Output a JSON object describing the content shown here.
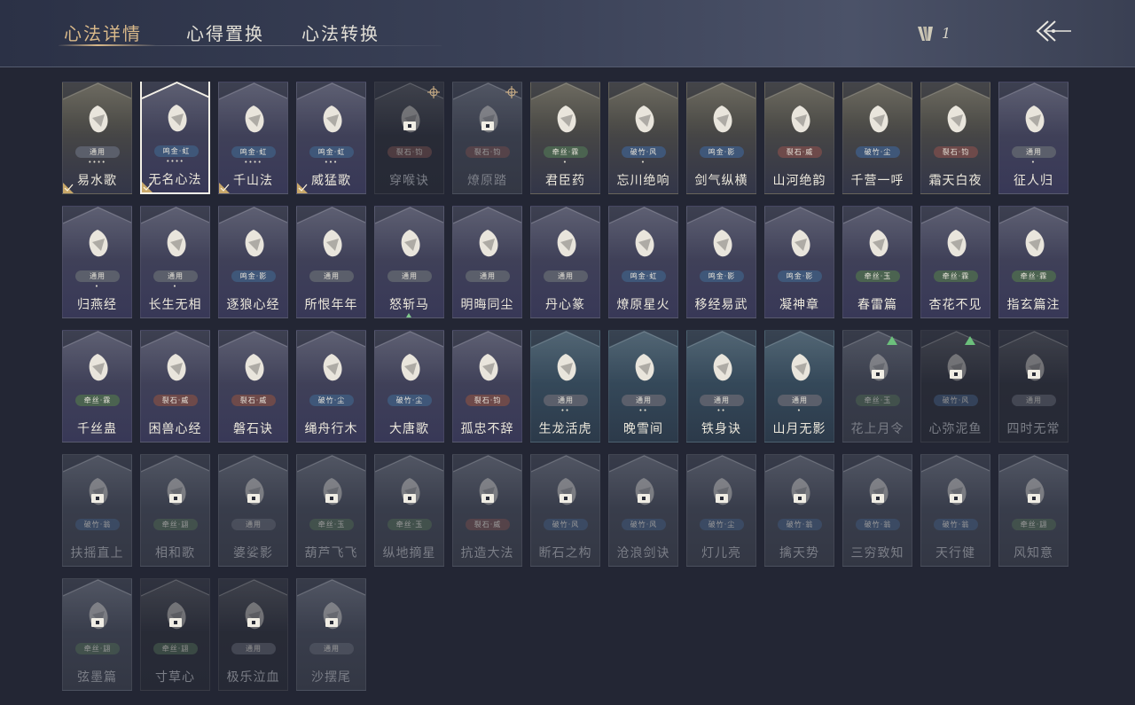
{
  "tabs": [
    {
      "label": "心法详情",
      "active": true
    },
    {
      "label": "心得置换",
      "active": false
    },
    {
      "label": "心法转换",
      "active": false
    }
  ],
  "counter": {
    "value": "1",
    "icon": "arrows-bundle-icon"
  },
  "back": {
    "icon": "back-arrow-icon"
  },
  "cards": [
    {
      "name": "易水歌",
      "tag": "通用",
      "tagType": "gen",
      "dots": "••••",
      "style": "gold",
      "icon": "horse-icon",
      "corner": true
    },
    {
      "name": "无名心法",
      "tag": "鸣金·虹",
      "tagType": "blue",
      "dots": "••••",
      "style": "purple",
      "icon": "sword-icon",
      "corner": true,
      "selected": true
    },
    {
      "name": "千山法",
      "tag": "鸣金·虹",
      "tagType": "blue",
      "dots": "••••",
      "style": "purple",
      "icon": "mountain-icon",
      "corner": true
    },
    {
      "name": "威猛歌",
      "tag": "鸣金·虹",
      "tagType": "blue",
      "dots": "•••",
      "style": "purple",
      "icon": "fist-icon",
      "corner": true
    },
    {
      "name": "穿喉诀",
      "tag": "裂石·钧",
      "tagType": "red",
      "dots": "",
      "style": "dark",
      "icon": "mask-icon",
      "lock": true,
      "target": true
    },
    {
      "name": "燎原踏",
      "tag": "裂石·钧",
      "tagType": "red",
      "dots": "",
      "style": "dim",
      "icon": "rider-icon",
      "lock": true,
      "target": true
    },
    {
      "name": "君臣药",
      "tag": "牵丝·霖",
      "tagType": "green",
      "dots": "•",
      "style": "gold",
      "icon": "jar-icon"
    },
    {
      "name": "忘川绝响",
      "tag": "破竹·风",
      "tagType": "blue",
      "dots": "•",
      "style": "gold",
      "icon": "face-icon"
    },
    {
      "name": "剑气纵横",
      "tag": "鸣金·影",
      "tagType": "blue",
      "dots": "",
      "style": "gold",
      "icon": "swords-icon"
    },
    {
      "name": "山河绝韵",
      "tag": "裂石·威",
      "tagType": "red",
      "dots": "",
      "style": "gold",
      "icon": "landscape-icon"
    },
    {
      "name": "千营一呼",
      "tag": "破竹·尘",
      "tagType": "blue",
      "dots": "",
      "style": "gold",
      "icon": "flag-icon"
    },
    {
      "name": "霜天白夜",
      "tag": "裂石·钧",
      "tagType": "red",
      "dots": "",
      "style": "gold",
      "icon": "spear-icon"
    },
    {
      "name": "征人归",
      "tag": "通用",
      "tagType": "gen",
      "dots": "•",
      "style": "purple",
      "icon": "bird-icon"
    },
    {
      "name": "归燕经",
      "tag": "通用",
      "tagType": "gen",
      "dots": "•",
      "style": "purple",
      "icon": "swallow-icon"
    },
    {
      "name": "长生无相",
      "tag": "通用",
      "tagType": "gen",
      "dots": "•",
      "style": "purple",
      "icon": "statue-icon"
    },
    {
      "name": "逐狼心经",
      "tag": "鸣金·影",
      "tagType": "blue",
      "dots": "",
      "style": "purple",
      "icon": "wolf-icon"
    },
    {
      "name": "所恨年年",
      "tag": "通用",
      "tagType": "gen",
      "dots": "",
      "style": "purple",
      "icon": "branch-icon"
    },
    {
      "name": "怒斩马",
      "tag": "通用",
      "tagType": "gen",
      "dots": "",
      "style": "purple",
      "icon": "blade-icon",
      "smalltri": true
    },
    {
      "name": "明晦同尘",
      "tag": "通用",
      "tagType": "gen",
      "dots": "",
      "style": "purple",
      "icon": "knot-icon"
    },
    {
      "name": "丹心篆",
      "tag": "通用",
      "tagType": "gen",
      "dots": "",
      "style": "purple",
      "icon": "seal-icon"
    },
    {
      "name": "燎原星火",
      "tag": "鸣金·虹",
      "tagType": "blue",
      "dots": "",
      "style": "purple",
      "icon": "scythe-icon"
    },
    {
      "name": "移经易武",
      "tag": "鸣金·影",
      "tagType": "blue",
      "dots": "",
      "style": "purple",
      "icon": "warrior-icon"
    },
    {
      "name": "凝神章",
      "tag": "鸣金·影",
      "tagType": "blue",
      "dots": "",
      "style": "purple",
      "icon": "bow-icon"
    },
    {
      "name": "春雷篇",
      "tag": "牵丝·玉",
      "tagType": "green",
      "dots": "",
      "style": "purple",
      "icon": "lightning-icon"
    },
    {
      "name": "杏花不见",
      "tag": "牵丝·霖",
      "tagType": "green",
      "dots": "",
      "style": "purple",
      "icon": "flower-icon"
    },
    {
      "name": "指玄篇注",
      "tag": "牵丝·霖",
      "tagType": "green",
      "dots": "",
      "style": "purple",
      "icon": "yinyang-icon"
    },
    {
      "name": "千丝蛊",
      "tag": "牵丝·霖",
      "tagType": "green",
      "dots": "",
      "style": "purple",
      "icon": "leaf-icon"
    },
    {
      "name": "困兽心经",
      "tag": "裂石·威",
      "tagType": "red",
      "dots": "",
      "style": "purple",
      "icon": "cage-icon"
    },
    {
      "name": "磐石诀",
      "tag": "裂石·威",
      "tagType": "red",
      "dots": "",
      "style": "purple",
      "icon": "rock-icon"
    },
    {
      "name": "绳舟行木",
      "tag": "破竹·尘",
      "tagType": "blue",
      "dots": "",
      "style": "purple",
      "icon": "roots-icon"
    },
    {
      "name": "大唐歌",
      "tag": "破竹·尘",
      "tagType": "blue",
      "dots": "",
      "style": "purple",
      "icon": "palace-icon"
    },
    {
      "name": "孤忠不辞",
      "tag": "裂石·钧",
      "tagType": "red",
      "dots": "",
      "style": "purple",
      "icon": "crossed-weapons-icon"
    },
    {
      "name": "生龙活虎",
      "tag": "通用",
      "tagType": "gen",
      "dots": "••",
      "style": "teal",
      "icon": "hammer-circle-icon"
    },
    {
      "name": "晚雪间",
      "tag": "通用",
      "tagType": "gen",
      "dots": "••",
      "style": "teal",
      "icon": "cross-circle-icon"
    },
    {
      "name": "铁身诀",
      "tag": "通用",
      "tagType": "gen",
      "dots": "••",
      "style": "teal",
      "icon": "body-circle-icon"
    },
    {
      "name": "山月无影",
      "tag": "通用",
      "tagType": "gen",
      "dots": "•",
      "style": "teal",
      "icon": "claw-icon"
    },
    {
      "name": "花上月令",
      "tag": "牵丝·玉",
      "tagType": "green",
      "dots": "",
      "style": "dim",
      "icon": "moon-flower-icon",
      "lock": true,
      "uptri": true
    },
    {
      "name": "心弥泥鱼",
      "tag": "破竹·风",
      "tagType": "blue",
      "dots": "",
      "style": "dark",
      "icon": "antler-icon",
      "lock": true,
      "uptri": true
    },
    {
      "name": "四时无常",
      "tag": "通用",
      "tagType": "gen",
      "dots": "",
      "style": "dark",
      "icon": "bird-dark-icon",
      "lock": true
    },
    {
      "name": "扶摇直上",
      "tag": "破竹·翁",
      "tagType": "blue",
      "dots": "",
      "style": "dim",
      "icon": "crane-icon",
      "lock": true
    },
    {
      "name": "相和歌",
      "tag": "牵丝·翃",
      "tagType": "green",
      "dots": "",
      "style": "dim",
      "icon": "snake-icon",
      "lock": true
    },
    {
      "name": "婆娑影",
      "tag": "通用",
      "tagType": "gen",
      "dots": "",
      "style": "dim",
      "icon": "dragon-icon",
      "lock": true
    },
    {
      "name": "葫芦飞飞",
      "tag": "牵丝·玉",
      "tagType": "green",
      "dots": "",
      "style": "dim",
      "icon": "gourd-icon",
      "lock": true
    },
    {
      "name": "纵地摘星",
      "tag": "牵丝·玉",
      "tagType": "green",
      "dots": "",
      "style": "dim",
      "icon": "dancer-icon",
      "lock": true
    },
    {
      "name": "抗造大法",
      "tag": "裂石·威",
      "tagType": "red",
      "dots": "",
      "style": "dim",
      "icon": "bell-icon",
      "lock": true
    },
    {
      "name": "断石之构",
      "tag": "破竹·风",
      "tagType": "blue",
      "dots": "",
      "style": "dim",
      "icon": "ghost-icon",
      "lock": true
    },
    {
      "name": "沧浪剑诀",
      "tag": "破竹·风",
      "tagType": "blue",
      "dots": "",
      "style": "dim",
      "icon": "spirit-icon",
      "lock": true
    },
    {
      "name": "灯儿亮",
      "tag": "破竹·尘",
      "tagType": "blue",
      "dots": "",
      "style": "dim",
      "icon": "lantern-icon",
      "lock": true
    },
    {
      "name": "擒天势",
      "tag": "破竹·翁",
      "tagType": "blue",
      "dots": "",
      "style": "dim",
      "icon": "chain-icon",
      "lock": true
    },
    {
      "name": "三穷致知",
      "tag": "破竹·翁",
      "tagType": "blue",
      "dots": "",
      "style": "dim",
      "icon": "scroll-icon",
      "lock": true
    },
    {
      "name": "天行健",
      "tag": "破竹·翁",
      "tagType": "blue",
      "dots": "",
      "style": "dim",
      "icon": "hat-icon",
      "lock": true
    },
    {
      "name": "风知意",
      "tag": "牵丝·翃",
      "tagType": "green",
      "dots": "",
      "style": "dim",
      "icon": "fan-icon",
      "lock": true
    },
    {
      "name": "弦墨篇",
      "tag": "牵丝·翃",
      "tagType": "green",
      "dots": "",
      "style": "dim",
      "icon": "ink-icon",
      "lock": true
    },
    {
      "name": "寸草心",
      "tag": "牵丝·翃",
      "tagType": "green",
      "dots": "",
      "style": "dark",
      "icon": "sprout-icon",
      "lock": true
    },
    {
      "name": "极乐泣血",
      "tag": "通用",
      "tagType": "gen",
      "dots": "",
      "style": "dark",
      "icon": "wing-icon",
      "lock": true
    },
    {
      "name": "沙摆尾",
      "tag": "通用",
      "tagType": "gen",
      "dots": "",
      "style": "dim",
      "icon": "swirl-icon",
      "lock": true
    }
  ]
}
